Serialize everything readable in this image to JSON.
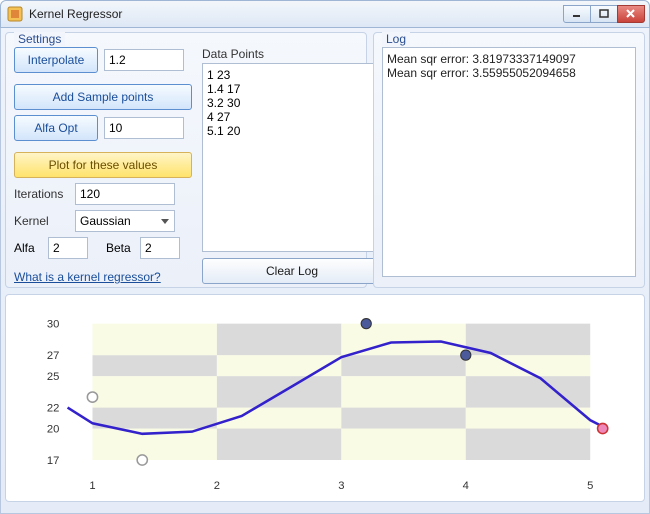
{
  "window": {
    "title": "Kernel Regressor"
  },
  "settings": {
    "legend": "Settings",
    "interpolate_label": "Interpolate",
    "interpolate_value": "1.2",
    "add_sample_label": "Add Sample points",
    "alfa_opt_label": "Alfa Opt",
    "alfa_opt_value": "10",
    "plot_label": "Plot for these values",
    "iterations_label": "Iterations",
    "iterations_value": "120",
    "kernel_label": "Kernel",
    "kernel_value": "Gaussian",
    "alfa_label": "Alfa",
    "alfa_value": "2",
    "beta_label": "Beta",
    "beta_value": "2",
    "help_link": "What is a kernel regressor?",
    "data_points_label": "Data Points",
    "data_points_text": "1 23\n1.4 17\n3.2 30\n4 27\n5.1 20",
    "clear_log_label": "Clear Log"
  },
  "log": {
    "legend": "Log",
    "lines": "Mean sqr error: 3.81973337149097\nMean sqr error: 3.55955052094658"
  },
  "chart_data": {
    "type": "line",
    "title": "",
    "xlabel": "",
    "ylabel": "",
    "x_ticks": [
      1,
      2,
      3,
      4,
      5
    ],
    "y_ticks": [
      17,
      20,
      22,
      25,
      27,
      30
    ],
    "xlim": [
      0.8,
      5.2
    ],
    "ylim": [
      16,
      31
    ],
    "series": [
      {
        "name": "fit",
        "type": "curve",
        "x": [
          0.8,
          1.0,
          1.4,
          1.8,
          2.2,
          2.6,
          3.0,
          3.4,
          3.8,
          4.2,
          4.6,
          5.0,
          5.1
        ],
        "y": [
          22.0,
          20.5,
          19.5,
          19.7,
          21.2,
          24.0,
          26.8,
          28.2,
          28.3,
          27.2,
          24.8,
          20.8,
          20.2
        ]
      }
    ],
    "points": [
      {
        "x": 1.0,
        "y": 23,
        "style": "open"
      },
      {
        "x": 1.4,
        "y": 17,
        "style": "open"
      },
      {
        "x": 3.2,
        "y": 30,
        "style": "solid"
      },
      {
        "x": 4.0,
        "y": 27,
        "style": "solid"
      },
      {
        "x": 5.1,
        "y": 20,
        "style": "red"
      }
    ]
  }
}
